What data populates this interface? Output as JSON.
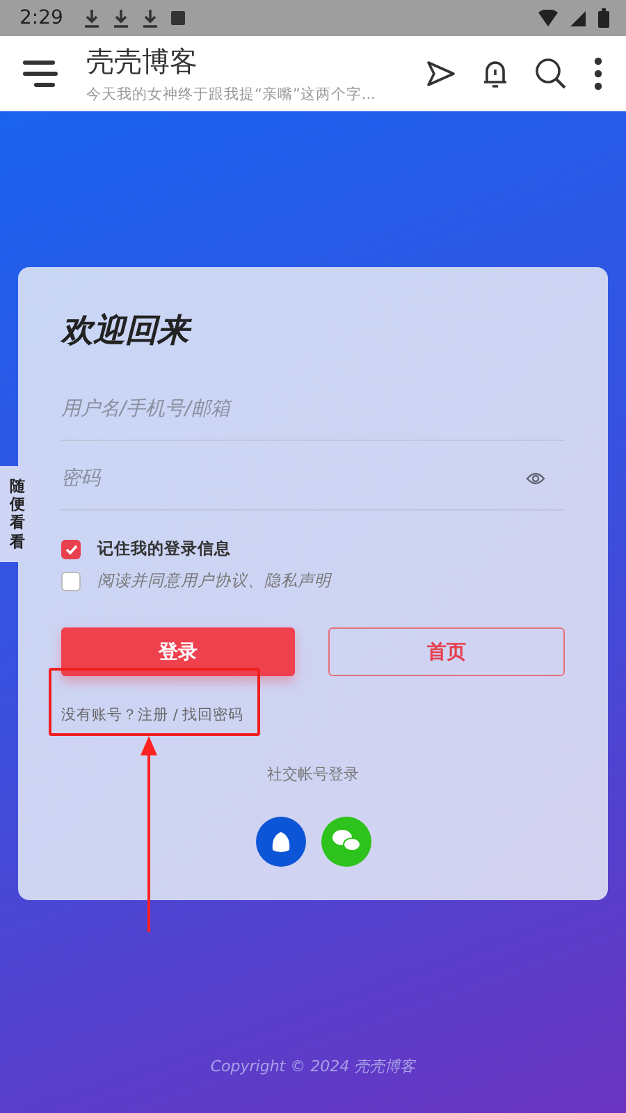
{
  "status_bar": {
    "time": "2:29"
  },
  "app_bar": {
    "title": "壳壳博客",
    "subtitle": "今天我的女神终于跟我提“亲嘴”这两个字..."
  },
  "side_tab": {
    "label": "随便看看"
  },
  "login": {
    "title": "欢迎回来",
    "fields": [
      {
        "kind": "text",
        "placeholder": "用户名/手机号/邮箱"
      },
      {
        "kind": "password",
        "placeholder": "密码"
      }
    ],
    "options": [
      {
        "label": "记住我的登录信息",
        "checked": true
      },
      {
        "label": "阅读并同意用户协议、隐私声明",
        "checked": false
      }
    ],
    "buttons": [
      {
        "kind": "primary",
        "label": "登录"
      },
      {
        "kind": "outline",
        "label": "首页"
      }
    ],
    "register_link": "没有账号？注册 / 找回密码",
    "social_label": "社交帐号登录",
    "social": [
      {
        "kind": "qq"
      },
      {
        "kind": "wechat"
      }
    ]
  },
  "footer": {
    "copyright": "Copyright © 2024 壳壳博客"
  }
}
